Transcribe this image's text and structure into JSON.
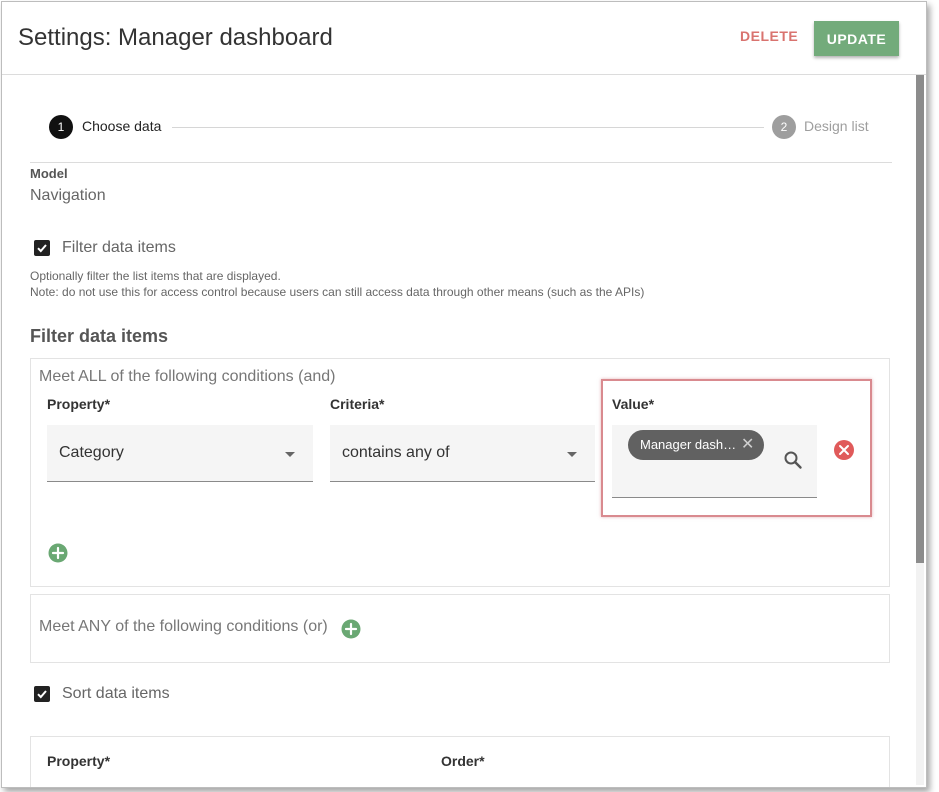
{
  "header": {
    "title": "Settings: Manager dashboard",
    "delete_label": "DELETE",
    "update_label": "UPDATE"
  },
  "stepper": {
    "steps": [
      {
        "number": "1",
        "label": "Choose data"
      },
      {
        "number": "2",
        "label": "Design list"
      }
    ]
  },
  "model": {
    "label": "Model",
    "value": "Navigation"
  },
  "filter_toggle": {
    "label": "Filter data items",
    "checked": true
  },
  "help": {
    "line1": "Optionally filter the list items that are displayed.",
    "line2": "Note: do not use this for access control because users can still access data through other means (such as the APIs)"
  },
  "filter_section": {
    "title": "Filter data items"
  },
  "and_group": {
    "title": "Meet ALL of the following conditions (and)",
    "property_label": "Property*",
    "criteria_label": "Criteria*",
    "value_label": "Value*",
    "property_value": "Category",
    "criteria_value": "contains any of",
    "chip_label": "Manager dash…"
  },
  "or_group": {
    "title": "Meet ANY of the following conditions (or)"
  },
  "sort_toggle": {
    "label": "Sort data items",
    "checked": true
  },
  "sort_panel": {
    "property_label": "Property*",
    "order_label": "Order*"
  },
  "icons": {
    "check": "check-icon",
    "search": "search-icon",
    "remove": "remove-circle-icon",
    "add": "add-circle-icon",
    "chip_close": "close-icon"
  },
  "colors": {
    "update": "#73ab7b",
    "delete": "#d9736f",
    "add": "#6aa873",
    "remove": "#e05a5a",
    "highlight": "#d98a8f"
  }
}
